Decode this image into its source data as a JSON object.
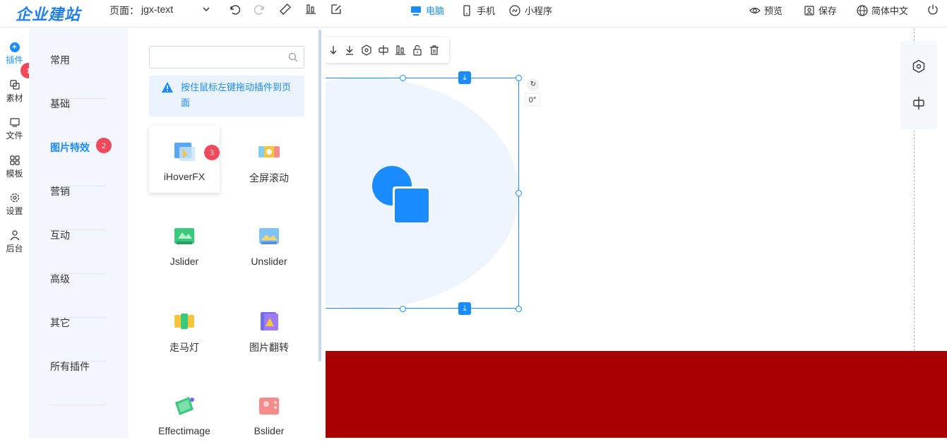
{
  "brand": {
    "logo_text": "企业建站"
  },
  "header": {
    "page_label": "页面：",
    "page_name": "jgx-text",
    "devices": [
      {
        "label": "电脑",
        "icon": "desktop-icon",
        "active": true
      },
      {
        "label": "手机",
        "icon": "mobile-icon",
        "active": false
      },
      {
        "label": "小程序",
        "icon": "miniprogram-icon",
        "active": false
      }
    ],
    "actions": {
      "preview": "预览",
      "save": "保存",
      "language": "简体中文"
    }
  },
  "rail": {
    "items": [
      {
        "label": "插件",
        "icon": "plus-icon",
        "active": true
      },
      {
        "label": "素材",
        "icon": "material-icon"
      },
      {
        "label": "文件",
        "icon": "folder-icon"
      },
      {
        "label": "模板",
        "icon": "grid-icon"
      },
      {
        "label": "设置",
        "icon": "gear-icon"
      },
      {
        "label": "后台",
        "icon": "user-icon"
      }
    ]
  },
  "categories": {
    "items": [
      "常用",
      "基础",
      "图片特效",
      "营销",
      "互动",
      "高级",
      "其它",
      "所有插件"
    ],
    "active": "图片特效"
  },
  "panel": {
    "search_placeholder": "",
    "tip": "按住鼠标左键拖动插件到页面",
    "plugins": [
      {
        "label": "iHoverFX",
        "icon": "ihoverfx-icon"
      },
      {
        "label": "全屏滚动",
        "icon": "fullscreen-scroll-icon"
      },
      {
        "label": "Jslider",
        "icon": "jslider-icon"
      },
      {
        "label": "Unslider",
        "icon": "unslider-icon"
      },
      {
        "label": "走马灯",
        "icon": "carousel-icon"
      },
      {
        "label": "图片翻转",
        "icon": "image-flip-icon"
      },
      {
        "label": "Effectimage",
        "icon": "effectimage-icon"
      },
      {
        "label": "Bslider",
        "icon": "bslider-icon"
      }
    ]
  },
  "badges": [
    "1",
    "2",
    "3"
  ],
  "canvas": {
    "rotation_label": "0°",
    "colors": {
      "accent": "#1a8cff",
      "band": "#a80000"
    }
  }
}
